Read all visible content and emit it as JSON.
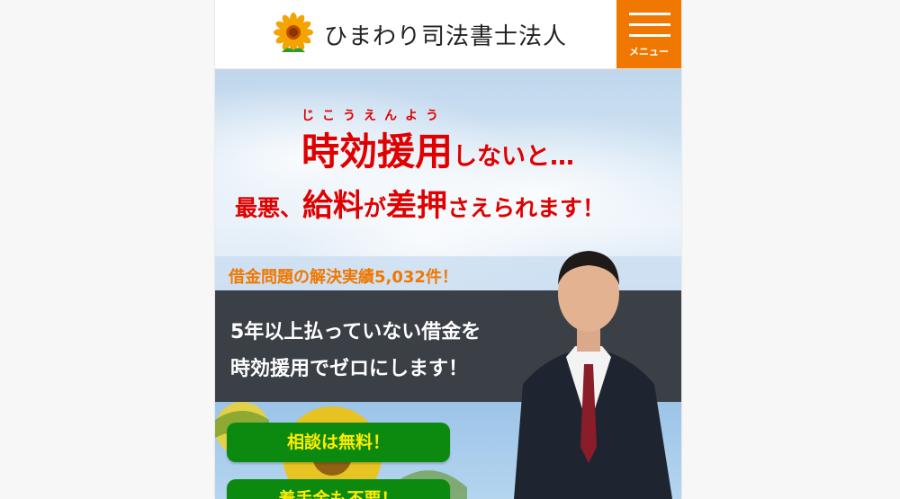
{
  "header": {
    "site_name": "ひまわり司法書士法人",
    "menu_label": "メニュー"
  },
  "hero": {
    "ruby": "じこうえんよう",
    "headline1_main": "時効援用",
    "headline1_rest": "しないと…",
    "headline2_a": "最悪、",
    "headline2_b": "給料",
    "headline2_c": "が",
    "headline2_d": "差押",
    "headline2_e": "さえられます！",
    "results": "借金問題の解決実績5,032件！",
    "tagline1": "5年以上払っていない借金を",
    "tagline2": "時効援用でゼロにします！"
  },
  "buttons": {
    "free_consult": "相談は無料！",
    "no_upfront_fee": "着手金も不要！"
  },
  "colors": {
    "accent": "#f07800",
    "headline": "#e00000",
    "button_bg": "#0c8a10",
    "button_text": "#ffeb00"
  }
}
